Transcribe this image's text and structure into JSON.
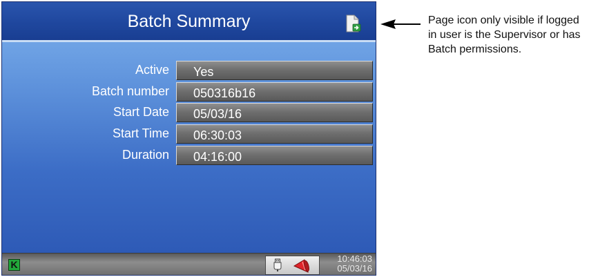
{
  "screen": {
    "title": "Batch Summary",
    "page_icon": "page-export-icon",
    "fields": [
      {
        "label": "Active",
        "value": "Yes"
      },
      {
        "label": "Batch number",
        "value": "050316b16"
      },
      {
        "label": "Start Date",
        "value": "05/03/16"
      },
      {
        "label": "Start Time",
        "value": "06:30:03"
      },
      {
        "label": "Duration",
        "value": "04:16:00"
      }
    ]
  },
  "status_bar": {
    "logo_letter": "K",
    "usb_icon": "usb-icon",
    "alarm_icon": "alarm-siren-icon",
    "time": "10:46:03",
    "date": "05/03/16"
  },
  "annotation": {
    "text": "Page icon only visible if logged in user is the Supervisor or has Batch permissions."
  },
  "colors": {
    "title_bar": "#1f479e",
    "background_top": "#7fb3ee",
    "background_bottom": "#2a55b2",
    "field_box": "#6f6f6f",
    "alarm_red": "#e0252b",
    "logo_green": "#22a83a"
  }
}
